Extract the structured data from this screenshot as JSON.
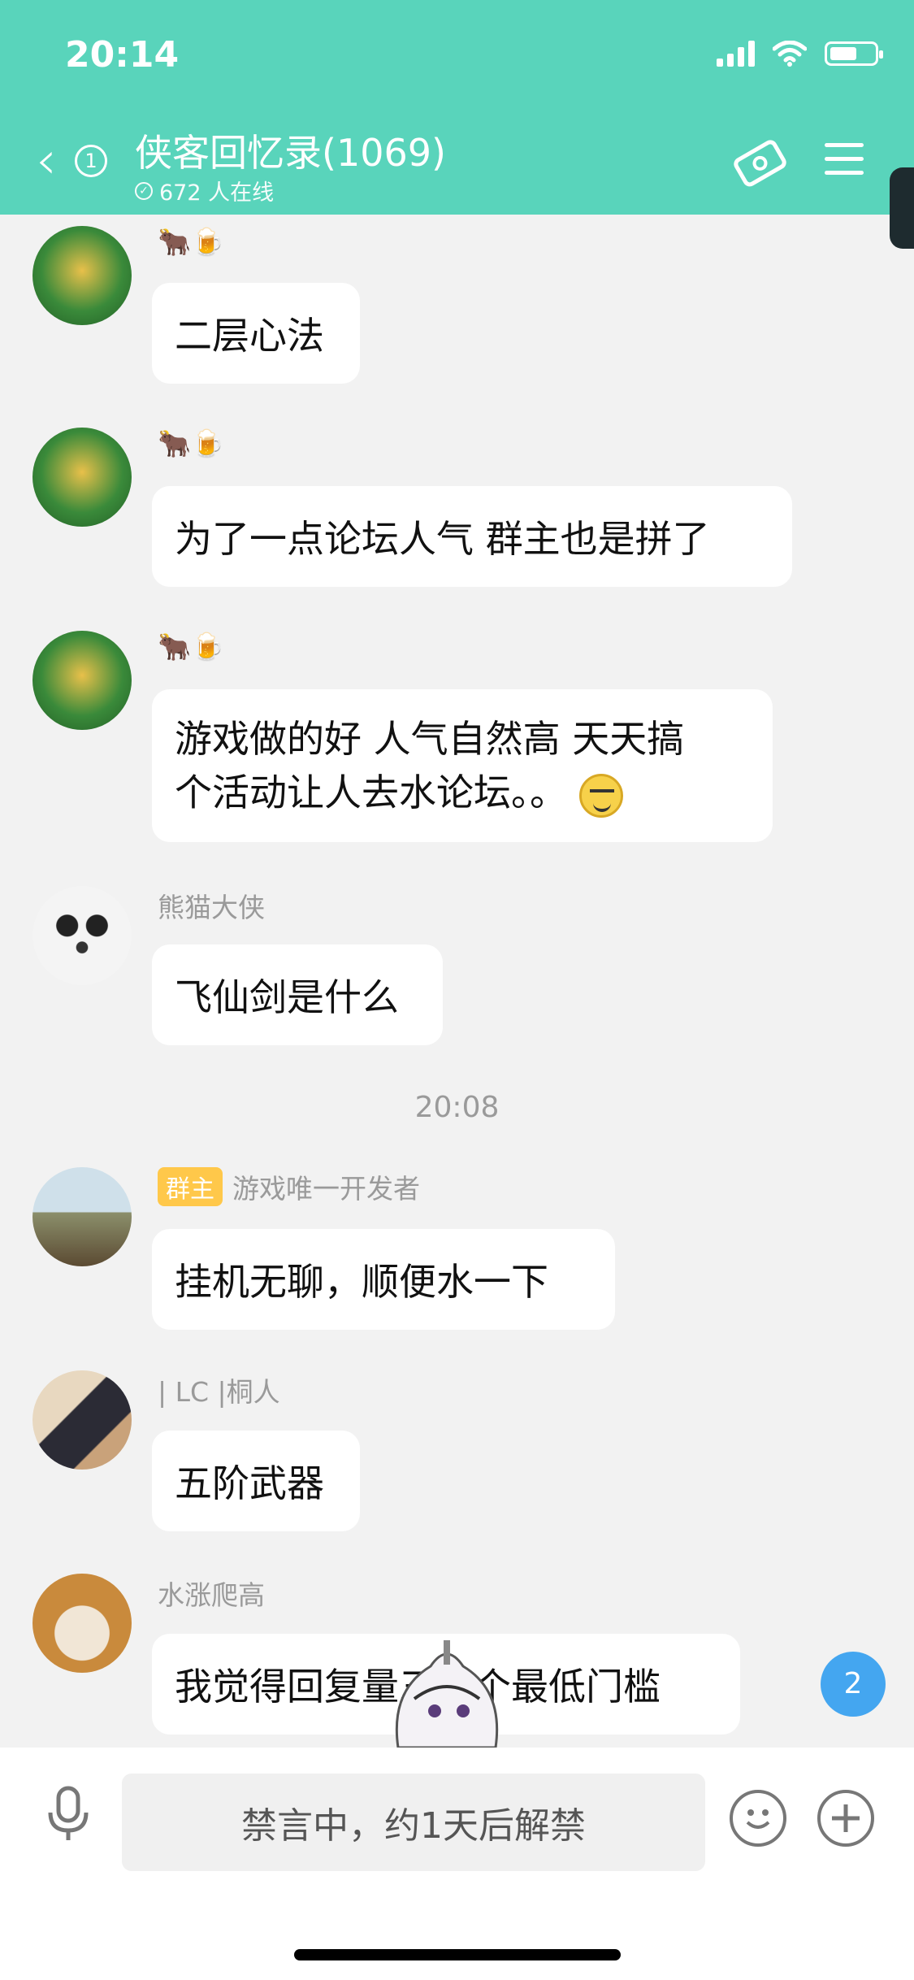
{
  "status_bar": {
    "time": "20:14"
  },
  "header": {
    "back_count": "1",
    "title": "侠客回忆录(1069)",
    "online_text": "672 人在线",
    "icons": [
      "back-chevron-icon",
      "ticket-icon",
      "menu-icon"
    ]
  },
  "messages": [
    {
      "sender": "🐂🍺",
      "text_lines": [
        "二层心法"
      ]
    },
    {
      "sender": "🐂🍺",
      "text_lines": [
        "为了一点论坛人气 群主也是拼了"
      ]
    },
    {
      "sender": "🐂🍺",
      "text_lines": [
        "游戏做的好 人气自然高  天天搞",
        "个活动让人去水论坛。。"
      ]
    },
    {
      "sender": "熊猫大侠",
      "text_lines": [
        "飞仙剑是什么"
      ]
    },
    {
      "sender": "游戏唯一开发者",
      "badge": "群主",
      "text_lines": [
        "挂机无聊，顺便水一下"
      ]
    },
    {
      "sender": "| LC |桐人",
      "text_lines": [
        "五阶武器"
      ]
    },
    {
      "sender": "水涨爬高",
      "text_lines": [
        "我觉得回复量三方个最低门槛"
      ]
    }
  ],
  "time_divider": "20:08",
  "unread_badge": "2",
  "input": {
    "placeholder": "禁言中，约1天后解禁"
  },
  "colors": {
    "header": "#59d4bb",
    "badge": "#ffc84a",
    "unread": "#44a6f0"
  }
}
